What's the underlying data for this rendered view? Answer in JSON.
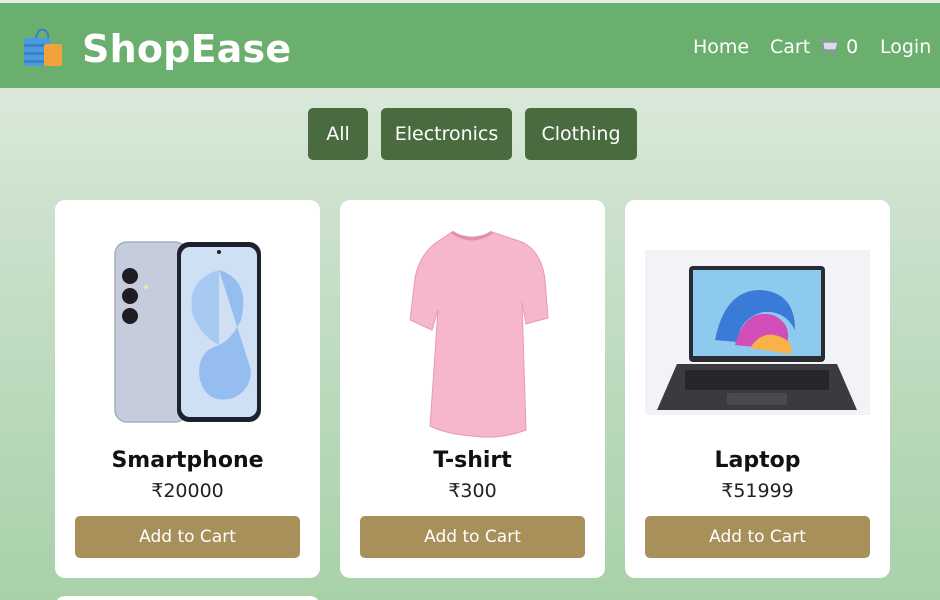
{
  "brand": {
    "name": "ShopEase"
  },
  "nav": {
    "home": "Home",
    "cart": "Cart",
    "cart_count": "0",
    "login": "Login"
  },
  "filters": [
    "All",
    "Electronics",
    "Clothing"
  ],
  "products": [
    {
      "name": "Smartphone",
      "price": "₹20000",
      "button": "Add to Cart",
      "image_icon": "smartphone-image"
    },
    {
      "name": "T-shirt",
      "price": "₹300",
      "button": "Add to Cart",
      "image_icon": "tshirt-image"
    },
    {
      "name": "Laptop",
      "price": "₹51999",
      "button": "Add to Cart",
      "image_icon": "laptop-image"
    }
  ],
  "colors": {
    "navbar": "#6aaf6d",
    "filter_button": "#4a6b40",
    "add_to_cart_button": "#a8905a",
    "card": "#ffffff"
  }
}
